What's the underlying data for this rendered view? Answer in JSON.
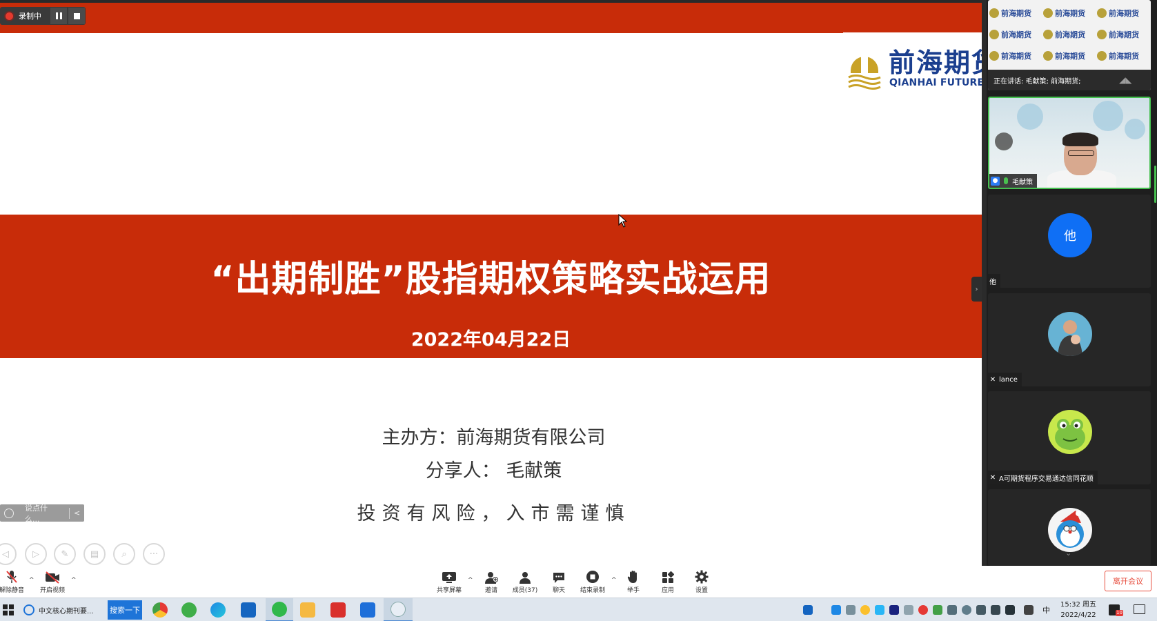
{
  "recording": {
    "status_label": "录制中"
  },
  "slide": {
    "logo_cn": "前海期货",
    "logo_en": "QIANHAI FUTURES",
    "title": "“出期制胜”股指期权策略实战运用",
    "date": "2022年04月22日",
    "host_line": "主办方：前海期货有限公司",
    "speaker_line": "分享人： 毛献策",
    "risk_line": "投资有风险，入市需谨慎",
    "comment_placeholder": "说点什么..."
  },
  "panel": {
    "sharing_watermark": "前海期货",
    "sharing_caption": "正在讲话: 毛献策; 前海期货;",
    "participants": [
      {
        "name": "毛献策",
        "speaking": true
      },
      {
        "name": "他",
        "avatar_letter": "他"
      },
      {
        "name": "lance"
      },
      {
        "name": "A可期货程序交易通达信同花顺"
      },
      {
        "name": ""
      }
    ]
  },
  "controls": {
    "unmute": "解除静音",
    "start_video": "开启视频",
    "share_screen": "共享屏幕",
    "invite": "邀请",
    "members": "成员(37)",
    "chat": "聊天",
    "end_recording": "结束录制",
    "raise_hand": "举手",
    "apps": "应用",
    "settings": "设置",
    "leave": "离开会议"
  },
  "taskbar": {
    "ie_label": "中文核心期刊要...",
    "search_button": "搜索一下",
    "ime": "中",
    "time": "15:32 周五",
    "date": "2022/4/22",
    "notification_count": "10"
  },
  "colors": {
    "slide_red": "#c82c09",
    "logo_blue": "#1b3f8f",
    "speaking_green": "#45c04f",
    "leave_red": "#e74c3c"
  }
}
